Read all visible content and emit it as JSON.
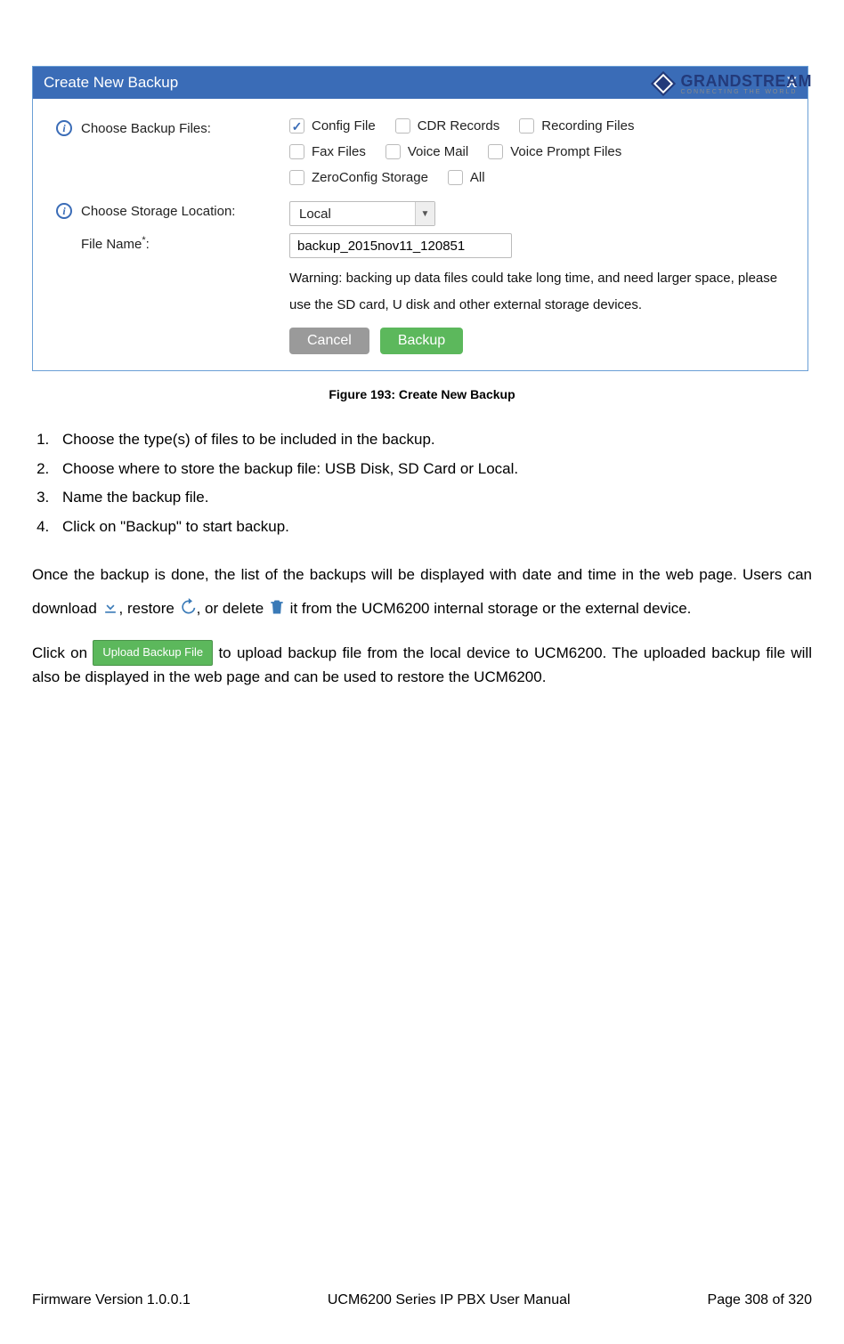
{
  "header": {
    "brand": "GRANDSTREAM",
    "tagline": "CONNECTING THE WORLD"
  },
  "dialog": {
    "title": "Create New Backup",
    "close": "X",
    "labels": {
      "backup_files": "Choose Backup Files:",
      "storage_location": "Choose Storage Location:",
      "file_name": "File Name",
      "file_name_suffix": ":"
    },
    "checkboxes": {
      "config_file": {
        "label": "Config File",
        "checked": true
      },
      "cdr_records": {
        "label": "CDR Records",
        "checked": false
      },
      "recording_files": {
        "label": "Recording Files",
        "checked": false
      },
      "fax_files": {
        "label": "Fax Files",
        "checked": false
      },
      "voice_mail": {
        "label": "Voice Mail",
        "checked": false
      },
      "voice_prompt": {
        "label": "Voice Prompt Files",
        "checked": false
      },
      "zeroconfig": {
        "label": "ZeroConfig Storage",
        "checked": false
      },
      "all": {
        "label": "All",
        "checked": false
      }
    },
    "storage_value": "Local",
    "file_name_value": "backup_2015nov11_120851",
    "warning": "Warning: backing up data files could take long time, and need larger space, please use the SD card, U disk and other external storage devices.",
    "buttons": {
      "cancel": "Cancel",
      "backup": "Backup"
    }
  },
  "figure_caption": "Figure 193: Create New Backup",
  "steps": [
    "Choose the type(s) of files to be included in the backup.",
    "Choose where to store the backup file: USB Disk, SD Card or Local.",
    "Name the backup file.",
    "Click on \"Backup\" to start backup."
  ],
  "paragraph1": {
    "p1": "Once the backup is done, the list of the backups will be displayed with date and time in the web page. Users can download ",
    "p2": ", restore ",
    "p3": ", or delete ",
    "p4": " it from the UCM6200 internal storage or the external device."
  },
  "paragraph2": {
    "p1": "Click on ",
    "upload_btn": "Upload Backup File",
    "p2": " to upload backup file from the local device to UCM6200. The uploaded backup file will also be displayed in the web page and can be used to restore the UCM6200."
  },
  "footer": {
    "left": "Firmware Version 1.0.0.1",
    "center": "UCM6200 Series IP PBX User Manual",
    "right": "Page 308 of 320"
  }
}
